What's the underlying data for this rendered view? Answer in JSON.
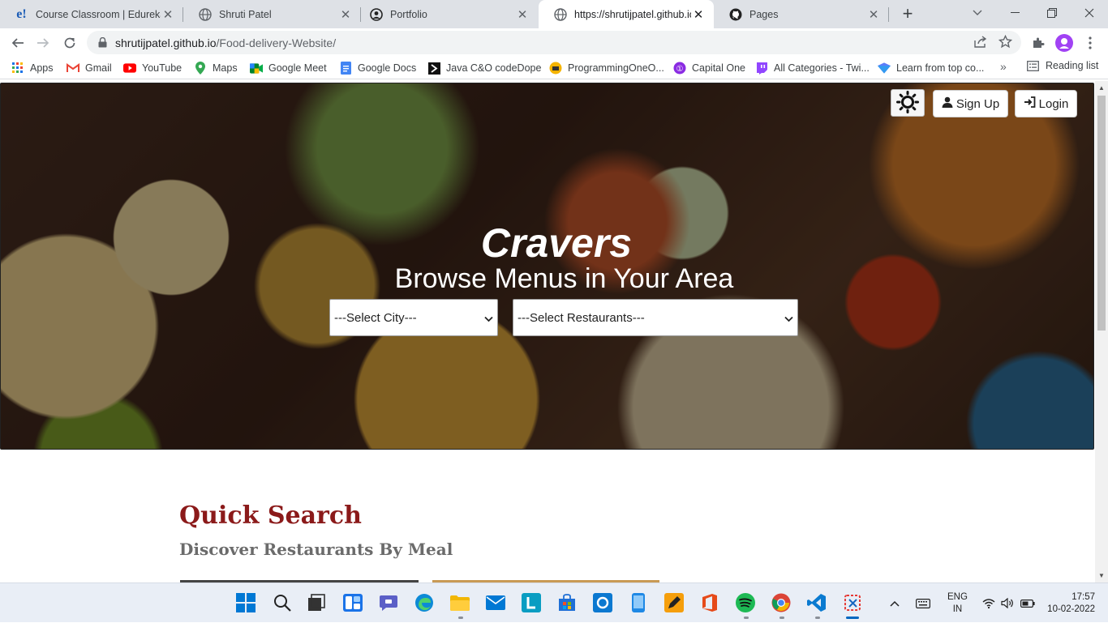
{
  "browser": {
    "tabs": [
      {
        "title": "Course Classroom | Edureka",
        "icon": "edureka-icon",
        "active": false
      },
      {
        "title": "Shruti Patel",
        "icon": "globe-icon",
        "active": false
      },
      {
        "title": "Portfolio",
        "icon": "portfolio-icon",
        "active": false
      },
      {
        "title": "https://shrutijpatel.github.io/",
        "icon": "globe-icon",
        "active": true
      },
      {
        "title": "Pages",
        "icon": "github-icon",
        "active": false
      }
    ],
    "url_host": "shrutijpatel.github.io",
    "url_path": "/Food-delivery-Website/",
    "bookmarks": [
      {
        "label": "Apps",
        "icon": "apps-grid-icon"
      },
      {
        "label": "Gmail",
        "icon": "gmail-icon"
      },
      {
        "label": "YouTube",
        "icon": "youtube-icon"
      },
      {
        "label": "Maps",
        "icon": "maps-icon"
      },
      {
        "label": "Google Meet",
        "icon": "meet-icon"
      },
      {
        "label": "Google Docs",
        "icon": "docs-icon"
      },
      {
        "label": "Java C&O codeDope",
        "icon": "codedope-icon"
      },
      {
        "label": "ProgrammingOneO...",
        "icon": "programming-icon"
      },
      {
        "label": "Capital One",
        "icon": "capital-one-icon"
      },
      {
        "label": "All Categories - Twi...",
        "icon": "twitch-icon"
      },
      {
        "label": "Learn from top co...",
        "icon": "learn-icon"
      }
    ],
    "reading_list": "Reading list"
  },
  "page": {
    "header": {
      "signup_label": "Sign Up",
      "login_label": "Login"
    },
    "hero": {
      "brand": "Cravers",
      "tagline": "Browse Menus in Your Area",
      "city_select": "---Select City---",
      "restaurant_select": "---Select Restaurants---"
    },
    "quick_search": {
      "title": "Quick Search",
      "subtitle": "Discover Restaurants By Meal"
    }
  },
  "taskbar": {
    "language": "ENG",
    "region": "IN",
    "time": "17:57",
    "date": "10-02-2022"
  },
  "colors": {
    "accent_title": "#8b1a1a",
    "subtitle_gray": "#6b6b6b",
    "taskbar_bg": "#e9eef6"
  }
}
